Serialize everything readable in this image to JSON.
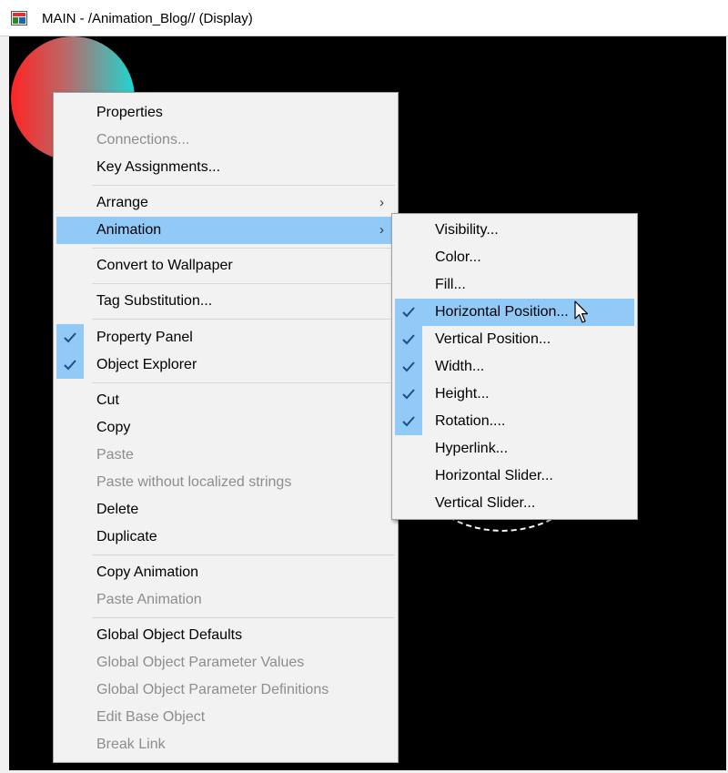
{
  "window": {
    "title": "MAIN - /Animation_Blog// (Display)",
    "icon": "display-icon"
  },
  "context_menu": {
    "items": [
      {
        "label": "Properties",
        "disabled": false
      },
      {
        "label": "Connections...",
        "disabled": true
      },
      {
        "label": "Key Assignments...",
        "disabled": false
      },
      {
        "label": "Arrange",
        "disabled": false,
        "submenu": true
      },
      {
        "label": "Animation",
        "disabled": false,
        "submenu": true,
        "highlighted": true
      },
      {
        "label": "Convert to Wallpaper",
        "disabled": false
      },
      {
        "label": "Tag Substitution...",
        "disabled": false
      },
      {
        "label": "Property Panel",
        "disabled": false,
        "checked": true
      },
      {
        "label": "Object Explorer",
        "disabled": false,
        "checked": true
      },
      {
        "label": "Cut",
        "disabled": false
      },
      {
        "label": "Copy",
        "disabled": false
      },
      {
        "label": "Paste",
        "disabled": true
      },
      {
        "label": "Paste without localized strings",
        "disabled": true
      },
      {
        "label": "Delete",
        "disabled": false
      },
      {
        "label": "Duplicate",
        "disabled": false
      },
      {
        "label": "Copy Animation",
        "disabled": false
      },
      {
        "label": "Paste Animation",
        "disabled": true
      },
      {
        "label": "Global Object Defaults",
        "disabled": false
      },
      {
        "label": "Global Object Parameter Values",
        "disabled": true
      },
      {
        "label": "Global Object Parameter Definitions",
        "disabled": true
      },
      {
        "label": "Edit Base Object",
        "disabled": true
      },
      {
        "label": "Break Link",
        "disabled": true
      }
    ]
  },
  "animation_submenu": {
    "items": [
      {
        "label": "Visibility...",
        "checked": false
      },
      {
        "label": "Color...",
        "checked": false
      },
      {
        "label": "Fill...",
        "checked": false
      },
      {
        "label": "Horizontal Position...",
        "checked": true,
        "highlighted": true
      },
      {
        "label": "Vertical Position...",
        "checked": true
      },
      {
        "label": "Width...",
        "checked": true
      },
      {
        "label": "Height...",
        "checked": true
      },
      {
        "label": "Rotation....",
        "checked": true
      },
      {
        "label": "Hyperlink...",
        "checked": false
      },
      {
        "label": "Horizontal Slider...",
        "checked": false
      },
      {
        "label": "Vertical Slider...",
        "checked": false
      }
    ]
  },
  "colors": {
    "highlight": "#91c9f7",
    "canvas": "#000000",
    "disabled_text": "#8d8d8d"
  }
}
